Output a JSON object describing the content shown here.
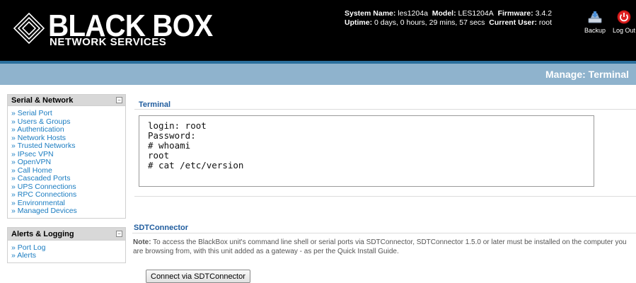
{
  "header": {
    "logo": {
      "main": "BLACK BOX",
      "sub": "NETWORK SERVICES"
    },
    "sysinfo": {
      "system_name_label": "System Name:",
      "system_name": "les1204a",
      "model_label": "Model:",
      "model": "LES1204A",
      "firmware_label": "Firmware:",
      "firmware": "3.4.2",
      "uptime_label": "Uptime:",
      "uptime": "0 days, 0 hours, 29 mins, 57 secs",
      "user_label": "Current User:",
      "user": "root"
    },
    "buttons": {
      "backup": "Backup",
      "logout": "Log Out"
    }
  },
  "page_title": "Manage: Terminal",
  "sidebar": {
    "sections": [
      {
        "title": "Serial & Network",
        "toggle": "−",
        "items": [
          "Serial Port",
          "Users & Groups",
          "Authentication",
          "Network Hosts",
          "Trusted Networks",
          "IPsec VPN",
          "OpenVPN",
          "Call Home",
          "Cascaded Ports",
          "UPS Connections",
          "RPC Connections",
          "Environmental",
          "Managed Devices"
        ]
      },
      {
        "title": "Alerts & Logging",
        "toggle": "−",
        "items": [
          "Port Log",
          "Alerts"
        ]
      }
    ]
  },
  "terminal": {
    "title": "Terminal",
    "lines": [
      "login: root",
      "Password:",
      "# whoami",
      "root",
      "# cat /etc/version"
    ]
  },
  "sdt": {
    "title": "SDTConnector",
    "note_label": "Note:",
    "note_text": " To access the BlackBox unit's command line shell or serial ports via SDTConnector, SDTConnector 1.5.0 or later must be installed on the computer you are browsing from, with this unit added as a gateway - as per the Quick Install Guide.",
    "button": "Connect via SDTConnector"
  },
  "colors": {
    "header_bg": "#000000",
    "titlebar_bg": "#8fb3cd",
    "link": "#1a7cc1",
    "section_title": "#1f5c9e",
    "logout_red": "#e02020"
  }
}
